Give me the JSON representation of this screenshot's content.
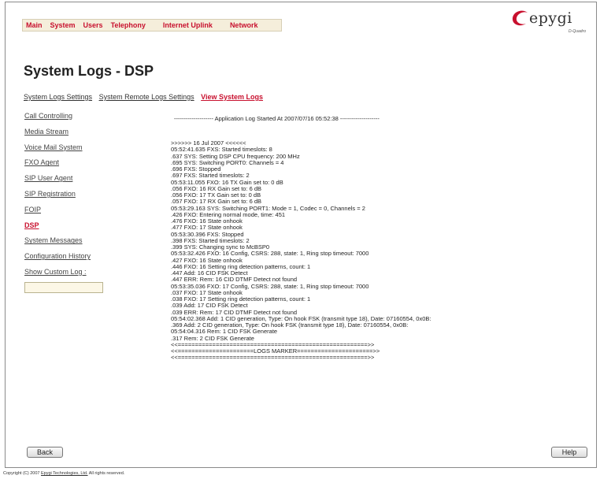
{
  "topnav": {
    "items": [
      "Main",
      "System",
      "Users",
      "Telephony",
      "Internet Uplink",
      "Network"
    ]
  },
  "brand": {
    "name": "epygi",
    "product": "D-Quadro",
    "accent": "#c8102e"
  },
  "page_title": "System Logs - DSP",
  "subtabs": [
    "System Logs Settings",
    "System Remote Logs Settings",
    "View System Logs"
  ],
  "sidebar": {
    "items": [
      "Call Controlling",
      "Media Stream",
      "Voice Mail System",
      "FXO Agent",
      "SIP User Agent",
      "SIP Registration",
      "FOIP",
      "DSP",
      "System Messages",
      "Configuration History",
      "Show Custom Log :"
    ],
    "custom_log_value": ""
  },
  "log": {
    "header": "-------------------- Application Log Started At 2007/07/16 05:52:38 --------------------",
    "lines": [
      ">>>>>> 16 Jul 2007 <<<<<<",
      "05:52:41.635 FXS: Started timeslots: 8",
      ".637 SYS: Setting DSP CPU frequency: 200 MHz",
      ".695 SYS: Switching PORT0: Channels = 4",
      ".696 FXS: Stopped",
      ".697 FXS: Started timeslots: 2",
      "05:53:11.055 FXO: 16 TX Gain set to: 0 dB",
      ".056 FXO: 16 RX Gain set to: 6 dB",
      ".056 FXO: 17 TX Gain set to: 0 dB",
      ".057 FXO: 17 RX Gain set to: 6 dB",
      "05:53:29.163 SYS: Switching PORT1: Mode = 1, Codec = 0, Channels = 2",
      ".426 FXO: Entering normal mode, time: 451",
      ".476 FXO: 16 State onhook",
      ".477 FXO: 17 State onhook",
      "05:53:30.396 FXS: Stopped",
      ".398 FXS: Started timeslots: 2",
      ".399 SYS: Changing sync to McBSP0",
      "05:53:32.426 FXO: 16 Config, CSRS: 288, state: 1, Ring stop timeout: 7000",
      ".427 FXO: 16 State onhook",
      ".446 FXO: 16 Setting ring detection patterns, count: 1",
      ".447 Add: 16 CID FSK Detect",
      ".447 ERR: Rem: 16 CID DTMF Detect not found",
      "05:53:35.036 FXO: 17 Config, CSRS: 288, state: 1, Ring stop timeout: 7000",
      ".037 FXO: 17 State onhook",
      ".038 FXO: 17 Setting ring detection patterns, count: 1",
      ".039 Add: 17 CID FSK Detect",
      ".039 ERR: Rem: 17 CID DTMF Detect not found",
      "05:54:02.368 Add: 1 CID generation, Type: On hook FSK (transmit type 18), Date: 07160554, 0x0B:",
      ".369 Add: 2 CID generation, Type: On hook FSK (transmit type 18), Date: 07160554, 0x0B:",
      "05:54:04.316 Rem: 1 CID FSK Generate",
      ".317 Rem: 2 CID FSK Generate",
      "<<=======================================================>>",
      "<<======================LOGS MARKER======================>>",
      "<<=======================================================>>"
    ]
  },
  "buttons": {
    "back": "Back",
    "help": "Help"
  },
  "footer": {
    "prefix": "Copyright (C) 2007 ",
    "link": "Epygi Technologies, Ltd.",
    "suffix": " All rights reserved."
  }
}
